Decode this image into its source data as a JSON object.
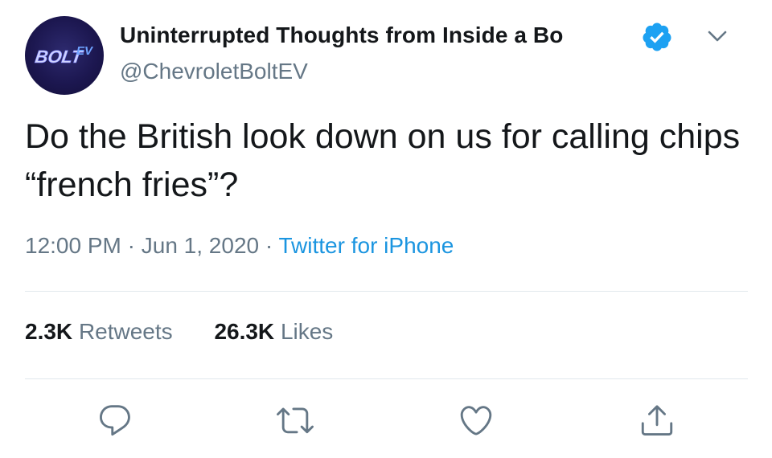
{
  "author": {
    "display_name": "Uninterrupted Thoughts from Inside a Bo",
    "handle": "@ChevroletBoltEV",
    "avatar_text": "BOLT EV",
    "verified": true
  },
  "tweet": {
    "text": "Do the British look down on us for calling chips “french fries”?",
    "time": "12:00 PM",
    "separator": "·",
    "date": "Jun 1, 2020",
    "source": "Twitter for iPhone"
  },
  "stats": {
    "retweets_count": "2.3K",
    "retweets_label": "Retweets",
    "likes_count": "26.3K",
    "likes_label": "Likes"
  },
  "actions": {
    "reply_icon": "reply-icon",
    "retweet_icon": "retweet-icon",
    "like_icon": "heart-icon",
    "share_icon": "share-icon"
  },
  "colors": {
    "link": "#1b95e0",
    "verified": "#1da1f2",
    "secondary_text": "#657786",
    "primary_text": "#14171a",
    "divider": "#e1e8ed"
  }
}
